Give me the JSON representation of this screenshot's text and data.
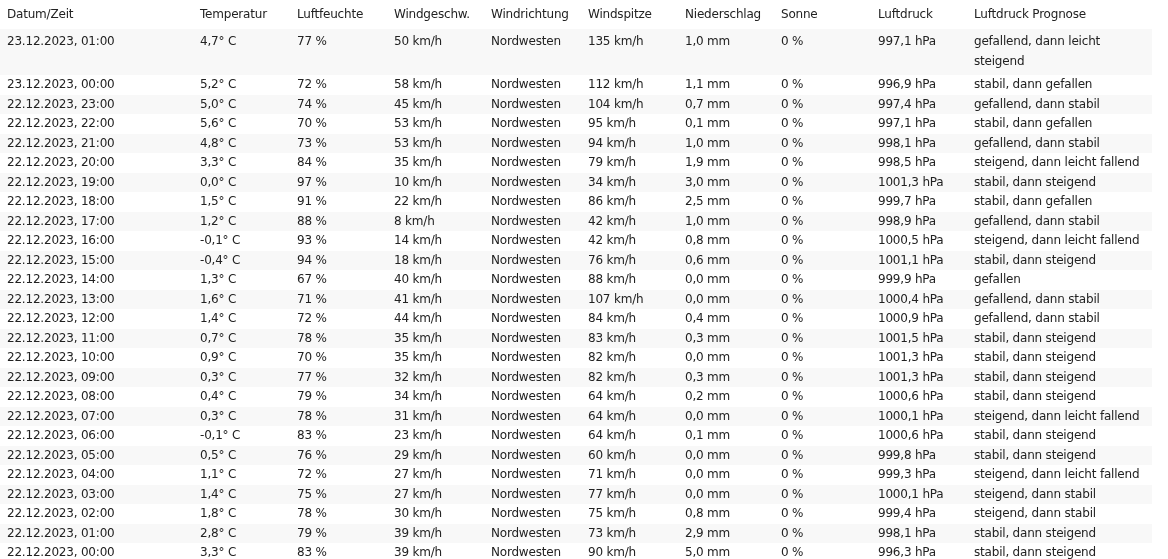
{
  "table": {
    "columns": [
      "Datum/Zeit",
      "Temperatur",
      "Luftfeuchte",
      "Windgeschw.",
      "Windrichtung",
      "Windspitze",
      "Niederschlag",
      "Sonne",
      "Luftdruck",
      "Luftdruck Prognose"
    ],
    "rows": [
      [
        "23.12.2023, 01:00",
        "4,7° C",
        "77 %",
        "50 km/h",
        "Nordwesten",
        "135 km/h",
        "1,0 mm",
        "0 %",
        "997,1 hPa",
        "gefallend, dann leicht steigend"
      ],
      [
        "23.12.2023, 00:00",
        "5,2° C",
        "72 %",
        "58 km/h",
        "Nordwesten",
        "112 km/h",
        "1,1 mm",
        "0 %",
        "996,9 hPa",
        "stabil, dann gefallen"
      ],
      [
        "22.12.2023, 23:00",
        "5,0° C",
        "74 %",
        "45 km/h",
        "Nordwesten",
        "104 km/h",
        "0,7 mm",
        "0 %",
        "997,4 hPa",
        "gefallend, dann stabil"
      ],
      [
        "22.12.2023, 22:00",
        "5,6° C",
        "70 %",
        "53 km/h",
        "Nordwesten",
        "95 km/h",
        "0,1 mm",
        "0 %",
        "997,1 hPa",
        "stabil, dann gefallen"
      ],
      [
        "22.12.2023, 21:00",
        "4,8° C",
        "73 %",
        "53 km/h",
        "Nordwesten",
        "94 km/h",
        "1,0 mm",
        "0 %",
        "998,1 hPa",
        "gefallend, dann stabil"
      ],
      [
        "22.12.2023, 20:00",
        "3,3° C",
        "84 %",
        "35 km/h",
        "Nordwesten",
        "79 km/h",
        "1,9 mm",
        "0 %",
        "998,5 hPa",
        "steigend, dann leicht fallend"
      ],
      [
        "22.12.2023, 19:00",
        "0,0° C",
        "97 %",
        "10 km/h",
        "Nordwesten",
        "34 km/h",
        "3,0 mm",
        "0 %",
        "1001,3 hPa",
        "stabil, dann steigend"
      ],
      [
        "22.12.2023, 18:00",
        "1,5° C",
        "91 %",
        "22 km/h",
        "Nordwesten",
        "86 km/h",
        "2,5 mm",
        "0 %",
        "999,7 hPa",
        "stabil, dann gefallen"
      ],
      [
        "22.12.2023, 17:00",
        "1,2° C",
        "88 %",
        "8 km/h",
        "Nordwesten",
        "42 km/h",
        "1,0 mm",
        "0 %",
        "998,9 hPa",
        "gefallend, dann stabil"
      ],
      [
        "22.12.2023, 16:00",
        "-0,1° C",
        "93 %",
        "14 km/h",
        "Nordwesten",
        "42 km/h",
        "0,8 mm",
        "0 %",
        "1000,5 hPa",
        "steigend, dann leicht fallend"
      ],
      [
        "22.12.2023, 15:00",
        "-0,4° C",
        "94 %",
        "18 km/h",
        "Nordwesten",
        "76 km/h",
        "0,6 mm",
        "0 %",
        "1001,1 hPa",
        "stabil, dann steigend"
      ],
      [
        "22.12.2023, 14:00",
        "1,3° C",
        "67 %",
        "40 km/h",
        "Nordwesten",
        "88 km/h",
        "0,0 mm",
        "0 %",
        "999,9 hPa",
        "gefallen"
      ],
      [
        "22.12.2023, 13:00",
        "1,6° C",
        "71 %",
        "41 km/h",
        "Nordwesten",
        "107 km/h",
        "0,0 mm",
        "0 %",
        "1000,4 hPa",
        "gefallend, dann stabil"
      ],
      [
        "22.12.2023, 12:00",
        "1,4° C",
        "72 %",
        "44 km/h",
        "Nordwesten",
        "84 km/h",
        "0,4 mm",
        "0 %",
        "1000,9 hPa",
        "gefallend, dann stabil"
      ],
      [
        "22.12.2023, 11:00",
        "0,7° C",
        "78 %",
        "35 km/h",
        "Nordwesten",
        "83 km/h",
        "0,3 mm",
        "0 %",
        "1001,5 hPa",
        "stabil, dann steigend"
      ],
      [
        "22.12.2023, 10:00",
        "0,9° C",
        "70 %",
        "35 km/h",
        "Nordwesten",
        "82 km/h",
        "0,0 mm",
        "0 %",
        "1001,3 hPa",
        "stabil, dann steigend"
      ],
      [
        "22.12.2023, 09:00",
        "0,3° C",
        "77 %",
        "32 km/h",
        "Nordwesten",
        "82 km/h",
        "0,3 mm",
        "0 %",
        "1001,3 hPa",
        "stabil, dann steigend"
      ],
      [
        "22.12.2023, 08:00",
        "0,4° C",
        "79 %",
        "34 km/h",
        "Nordwesten",
        "64 km/h",
        "0,2 mm",
        "0 %",
        "1000,6 hPa",
        "stabil, dann steigend"
      ],
      [
        "22.12.2023, 07:00",
        "0,3° C",
        "78 %",
        "31 km/h",
        "Nordwesten",
        "64 km/h",
        "0,0 mm",
        "0 %",
        "1000,1 hPa",
        "steigend, dann leicht fallend"
      ],
      [
        "22.12.2023, 06:00",
        "-0,1° C",
        "83 %",
        "23 km/h",
        "Nordwesten",
        "64 km/h",
        "0,1 mm",
        "0 %",
        "1000,6 hPa",
        "stabil, dann steigend"
      ],
      [
        "22.12.2023, 05:00",
        "0,5° C",
        "76 %",
        "29 km/h",
        "Nordwesten",
        "60 km/h",
        "0,0 mm",
        "0 %",
        "999,8 hPa",
        "stabil, dann steigend"
      ],
      [
        "22.12.2023, 04:00",
        "1,1° C",
        "72 %",
        "27 km/h",
        "Nordwesten",
        "71 km/h",
        "0,0 mm",
        "0 %",
        "999,3 hPa",
        "steigend, dann leicht fallend"
      ],
      [
        "22.12.2023, 03:00",
        "1,4° C",
        "75 %",
        "27 km/h",
        "Nordwesten",
        "77 km/h",
        "0,0 mm",
        "0 %",
        "1000,1 hPa",
        "steigend, dann stabil"
      ],
      [
        "22.12.2023, 02:00",
        "1,8° C",
        "78 %",
        "30 km/h",
        "Nordwesten",
        "75 km/h",
        "0,8 mm",
        "0 %",
        "999,4 hPa",
        "steigend, dann stabil"
      ],
      [
        "22.12.2023, 01:00",
        "2,8° C",
        "79 %",
        "39 km/h",
        "Nordwesten",
        "73 km/h",
        "2,9 mm",
        "0 %",
        "998,1 hPa",
        "stabil, dann steigend"
      ],
      [
        "22.12.2023, 00:00",
        "3,3° C",
        "83 %",
        "39 km/h",
        "Nordwesten",
        "90 km/h",
        "5,0 mm",
        "0 %",
        "996,3 hPa",
        "stabil, dann steigend"
      ]
    ]
  }
}
